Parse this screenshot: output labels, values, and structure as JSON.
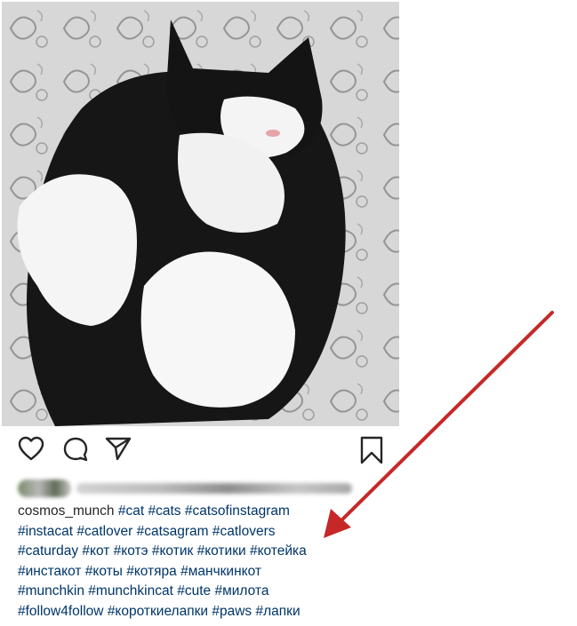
{
  "post": {
    "username": "cosmos_munch",
    "caption_lines": [
      [
        "#cat",
        "#cats",
        "#catsofinstagram"
      ],
      [
        "#instacat",
        "#catlover",
        "#catsagram",
        "#catlovers"
      ],
      [
        "#caturday",
        "#кот",
        "#котэ",
        "#котик",
        "#котики",
        "#котейка"
      ],
      [
        "#инстакот",
        "#коты",
        "#котяра",
        "#манчкинкот"
      ],
      [
        "#munchkin",
        "#munchkincat",
        "#cute",
        "#милота"
      ],
      [
        "#follow4follow",
        "#короткиелапки",
        "#paws",
        "#лапки"
      ]
    ]
  },
  "icons": {
    "like": "heart-icon",
    "comment": "comment-bubble-icon",
    "share": "paper-plane-icon",
    "save": "bookmark-icon"
  },
  "annotation": {
    "arrow_color": "#c62828"
  }
}
